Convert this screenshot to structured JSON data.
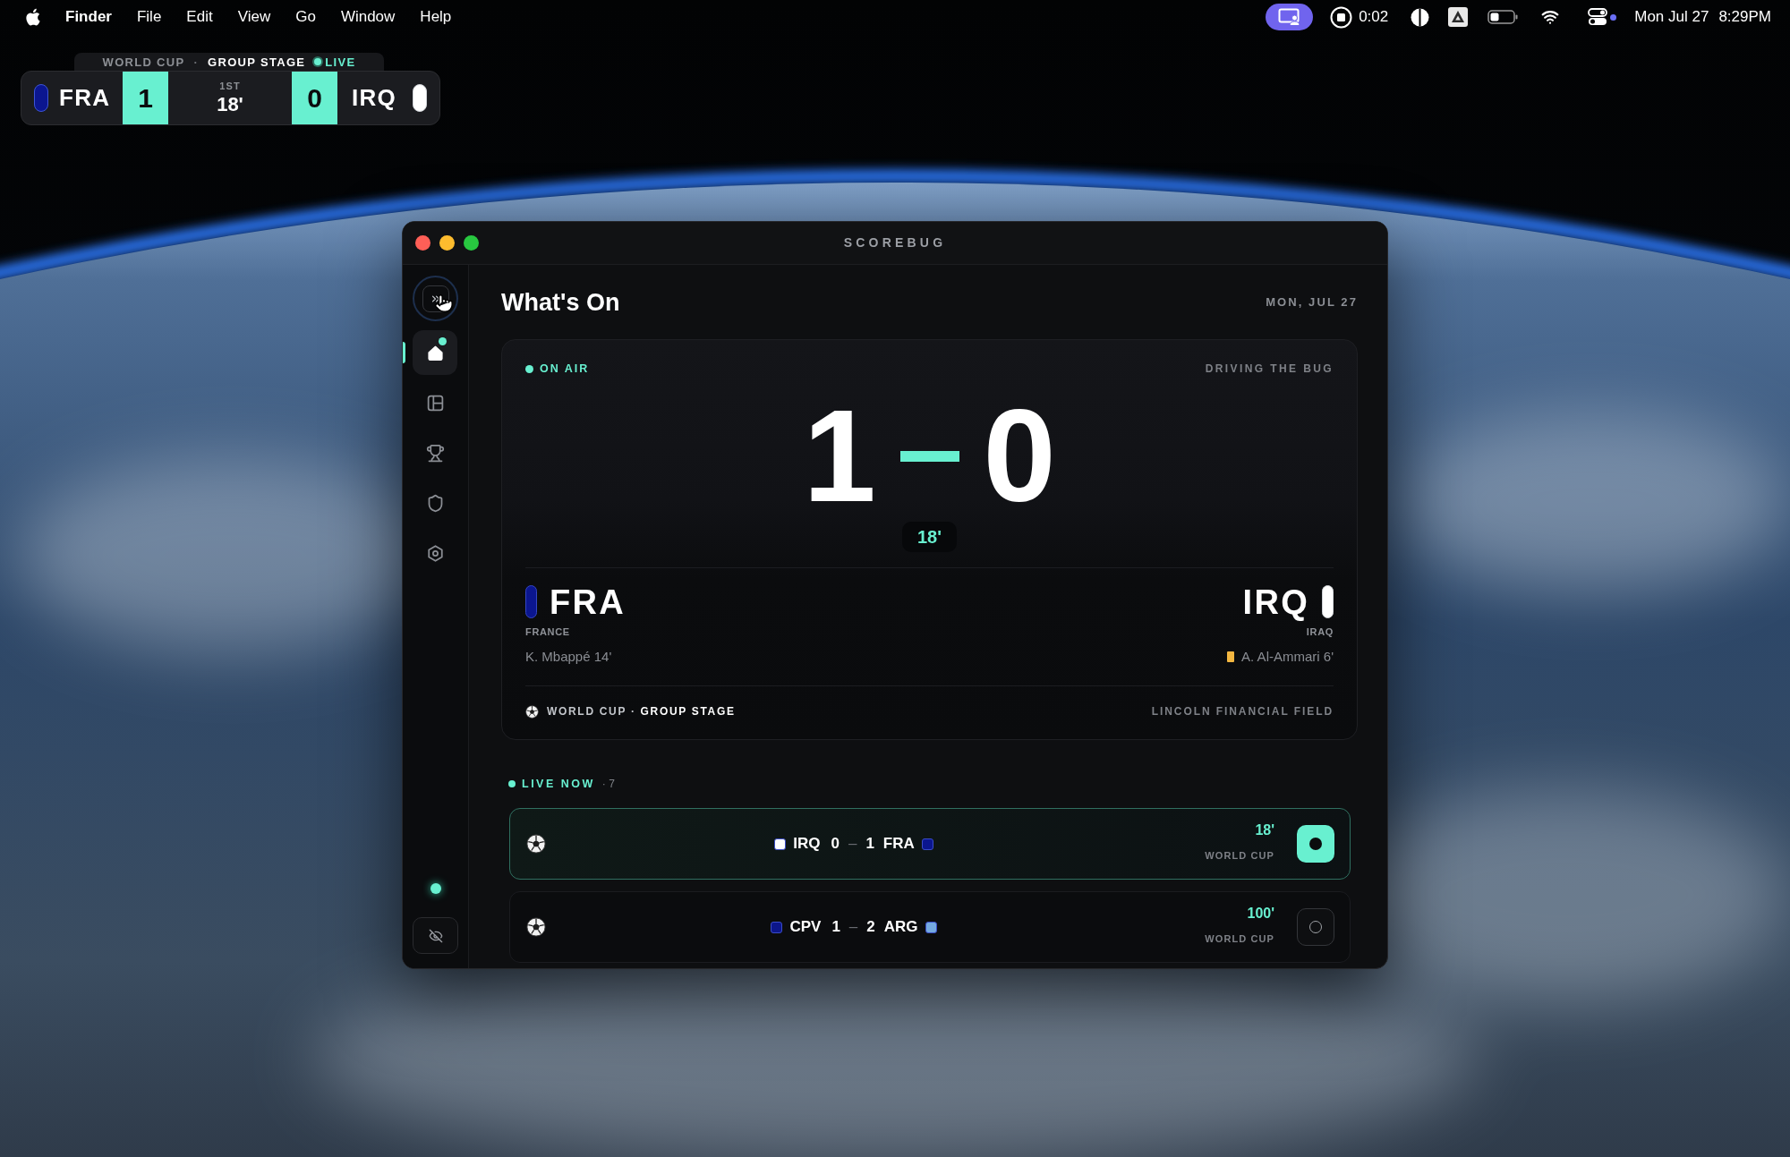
{
  "menu_bar": {
    "app_name": "Finder",
    "menus": [
      "File",
      "Edit",
      "View",
      "Go",
      "Window",
      "Help"
    ],
    "recording_time": "0:02",
    "date": "Mon Jul 27",
    "time": "8:29PM"
  },
  "score_overlay": {
    "competition": "WORLD CUP",
    "separator": "·",
    "stage": "GROUP STAGE",
    "status": "LIVE",
    "period": "1ST",
    "clock": "18'",
    "home": {
      "code": "FRA",
      "score": "1",
      "color": "#0b168f"
    },
    "away": {
      "code": "IRQ",
      "score": "0",
      "color": "#ffffff"
    }
  },
  "window": {
    "title": "SCOREBUG"
  },
  "sidebar": {
    "items": [
      {
        "selected": true,
        "badge": true
      },
      {
        "selected": false,
        "badge": false
      },
      {
        "selected": false,
        "badge": false
      },
      {
        "selected": false,
        "badge": false
      },
      {
        "selected": false,
        "badge": false
      }
    ]
  },
  "header": {
    "title": "What's On",
    "date": "MON, JUL 27"
  },
  "on_air_card": {
    "status": "ON AIR",
    "role": "DRIVING THE BUG",
    "home_score": "1",
    "away_score": "0",
    "clock": "18'",
    "home": {
      "code": "FRA",
      "name": "FRANCE",
      "color": "#0b168f",
      "event": {
        "text": "K. Mbappé 14'"
      }
    },
    "away": {
      "code": "IRQ",
      "name": "IRAQ",
      "color": "#ffffff",
      "event": {
        "kind": "yellow_card",
        "text": "A. Al-Ammari 6'"
      }
    },
    "competition": "WORLD CUP · **GROUP STAGE**",
    "venue": "LINCOLN FINANCIAL FIELD"
  },
  "live_now": {
    "label": "LIVE NOW",
    "count": "· 7",
    "separator": "–",
    "matches": [
      {
        "home": {
          "code": "IRQ",
          "score": "0",
          "color": "#ffffff"
        },
        "away": {
          "code": "FRA",
          "score": "1",
          "color": "#0b168f"
        },
        "clock": "18'",
        "competition": "WORLD CUP",
        "selected": true
      },
      {
        "home": {
          "code": "CPV",
          "score": "1",
          "color": "#0c168a"
        },
        "away": {
          "code": "ARG",
          "score": "2",
          "color": "#74a9e0"
        },
        "clock": "100'",
        "competition": "WORLD CUP",
        "selected": false
      }
    ]
  }
}
